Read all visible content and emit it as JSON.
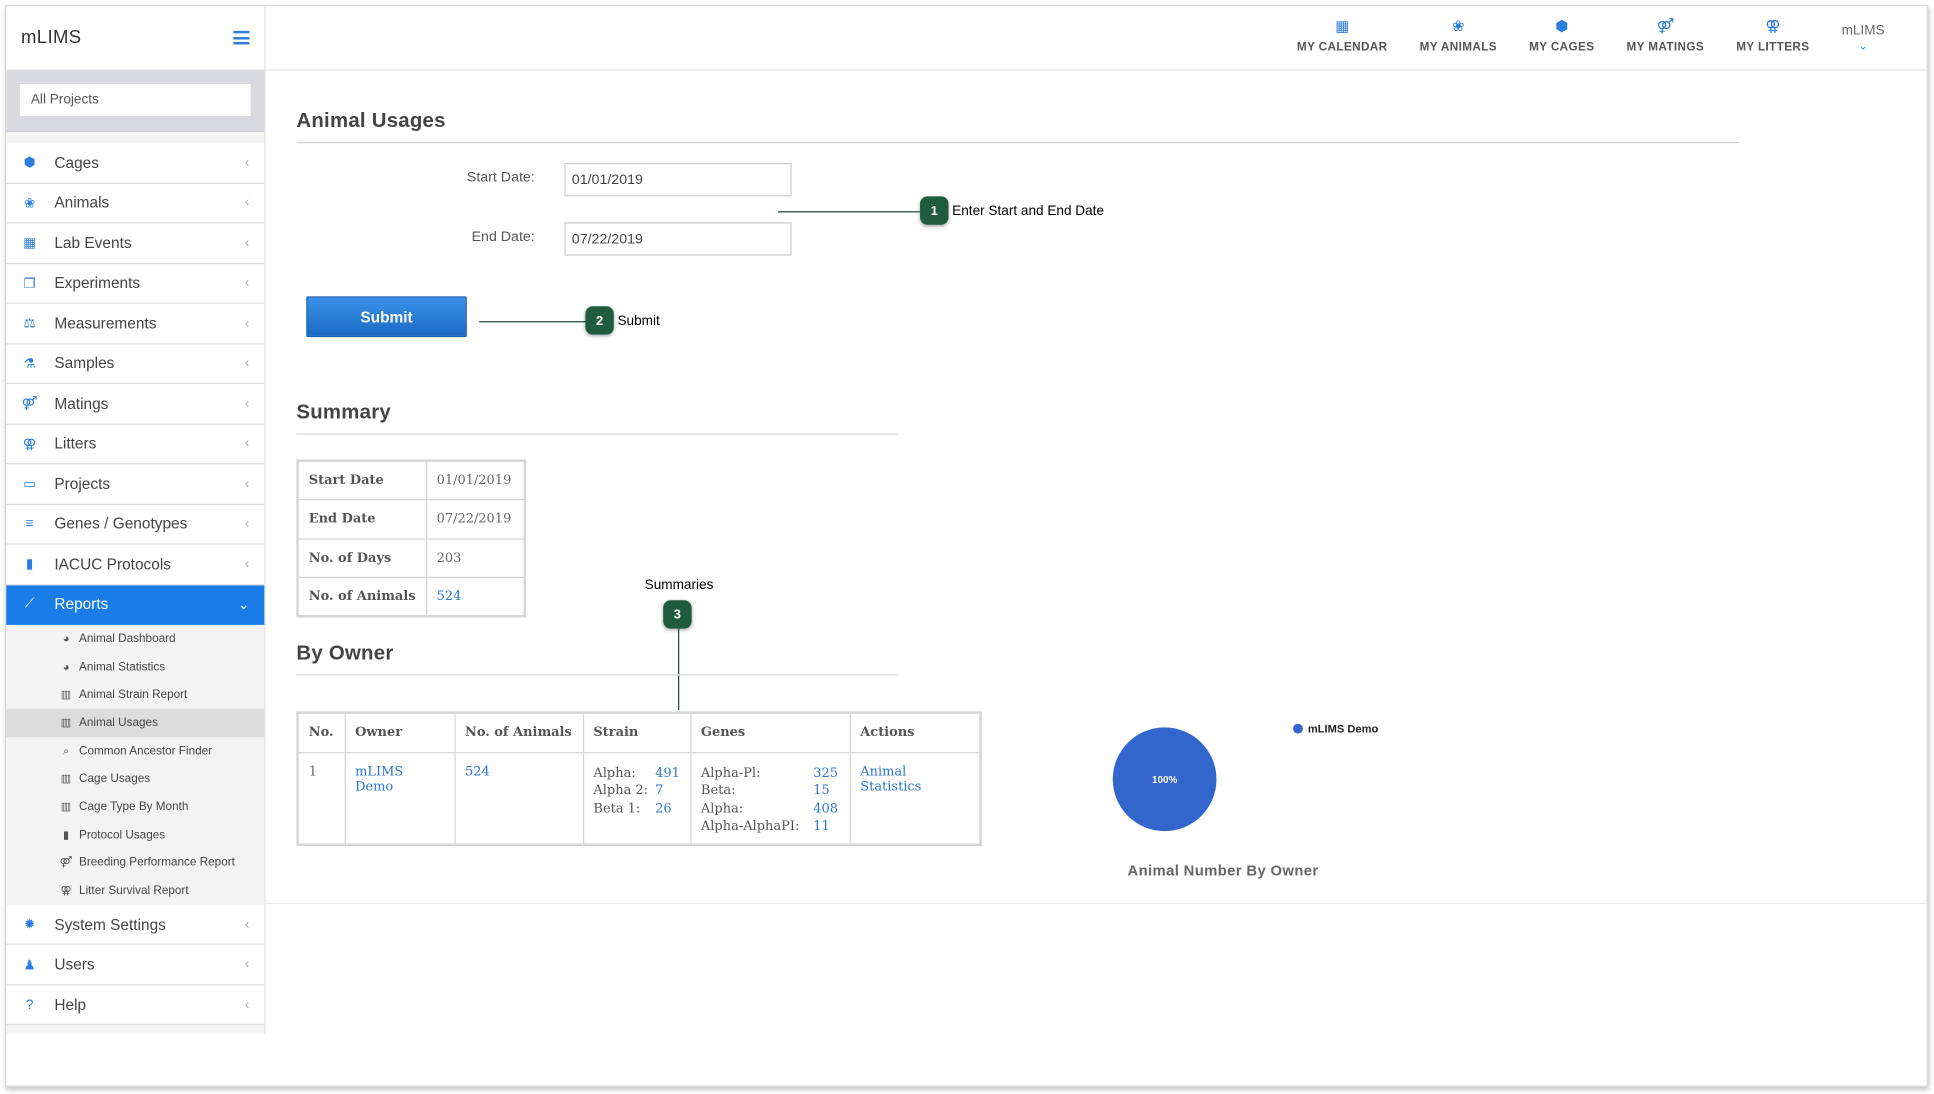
{
  "app": {
    "title": "mLIMS"
  },
  "project_selector": {
    "value": "All Projects"
  },
  "topnav": {
    "items": [
      {
        "label": "MY CALENDAR",
        "icon": "calendar-icon"
      },
      {
        "label": "MY ANIMALS",
        "icon": "paw-icon"
      },
      {
        "label": "MY CAGES",
        "icon": "cube-icon"
      },
      {
        "label": "MY MATINGS",
        "icon": "mating-icon"
      },
      {
        "label": "MY LITTERS",
        "icon": "litter-icon"
      }
    ],
    "user": "mLIMS"
  },
  "sidebar": {
    "items": [
      {
        "label": "Cages",
        "icon": "cube-icon"
      },
      {
        "label": "Animals",
        "icon": "paw-icon"
      },
      {
        "label": "Lab Events",
        "icon": "calendar-icon"
      },
      {
        "label": "Experiments",
        "icon": "copy-icon"
      },
      {
        "label": "Measurements",
        "icon": "scale-icon"
      },
      {
        "label": "Samples",
        "icon": "flask-icon"
      },
      {
        "label": "Matings",
        "icon": "mating-icon"
      },
      {
        "label": "Litters",
        "icon": "litter-icon"
      },
      {
        "label": "Projects",
        "icon": "folder-icon"
      },
      {
        "label": "Genes / Genotypes",
        "icon": "list-icon"
      },
      {
        "label": "IACUC Protocols",
        "icon": "book-icon"
      },
      {
        "label": "Reports",
        "icon": "chart-line-icon"
      },
      {
        "label": "System Settings",
        "icon": "gear-icon"
      },
      {
        "label": "Users",
        "icon": "users-icon"
      },
      {
        "label": "Help",
        "icon": "question-icon"
      }
    ],
    "reports_submenu": [
      {
        "label": "Animal Dashboard",
        "icon": "pie-icon"
      },
      {
        "label": "Animal Statistics",
        "icon": "pie-icon"
      },
      {
        "label": "Animal Strain Report",
        "icon": "bar-chart-icon"
      },
      {
        "label": "Animal Usages",
        "icon": "bar-chart-icon"
      },
      {
        "label": "Common Ancestor Finder",
        "icon": "search-icon"
      },
      {
        "label": "Cage Usages",
        "icon": "bar-chart-icon"
      },
      {
        "label": "Cage Type By Month",
        "icon": "bar-chart-icon"
      },
      {
        "label": "Protocol Usages",
        "icon": "book-icon"
      },
      {
        "label": "Breeding Performance Report",
        "icon": "mating-icon"
      },
      {
        "label": "Litter Survival Report",
        "icon": "litter-icon"
      }
    ]
  },
  "page": {
    "title": "Animal Usages",
    "form": {
      "start_label": "Start Date:",
      "start_value": "01/01/2019",
      "end_label": "End Date:",
      "end_value": "07/22/2019",
      "submit_label": "Submit"
    },
    "callouts": [
      {
        "number": "1",
        "text": "Enter Start and End Date"
      },
      {
        "number": "2",
        "text": "Submit"
      },
      {
        "number": "3",
        "text": "Summaries"
      }
    ],
    "summary": {
      "title": "Summary",
      "rows": [
        {
          "label": "Start Date",
          "value": "01/01/2019"
        },
        {
          "label": "End Date",
          "value": "07/22/2019"
        },
        {
          "label": "No. of Days",
          "value": "203"
        },
        {
          "label": "No. of Animals",
          "value": "524"
        }
      ]
    },
    "by_owner": {
      "title": "By Owner",
      "columns": [
        "No.",
        "Owner",
        "No. of Animals",
        "Strain",
        "Genes",
        "Actions"
      ],
      "row": {
        "no": "1",
        "owner": "mLIMS Demo",
        "animals": "524",
        "strains": [
          {
            "name": "Alpha:",
            "count": "491"
          },
          {
            "name": "Alpha 2:",
            "count": "7"
          },
          {
            "name": "Beta 1:",
            "count": "26"
          }
        ],
        "genes": [
          {
            "name": "Alpha-Pl:",
            "count": "325"
          },
          {
            "name": "Beta:",
            "count": "15"
          },
          {
            "name": "Alpha:",
            "count": "408"
          },
          {
            "name": "Alpha-AlphaPI:",
            "count": "11"
          }
        ],
        "action": "Animal Statistics"
      }
    }
  },
  "chart_data": {
    "type": "pie",
    "title": "Animal Number By Owner",
    "categories": [
      "mLIMS Demo"
    ],
    "values": [
      524
    ],
    "data_labels": [
      "100%"
    ],
    "colors": [
      "#3366cc"
    ],
    "legend_position": "top-right"
  },
  "colors": {
    "accent": "#1a7ce6",
    "callout": "#1f5c3e",
    "link": "#2a76d2"
  }
}
